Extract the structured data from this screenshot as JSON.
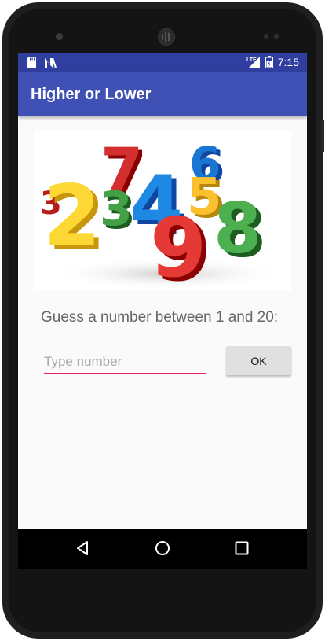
{
  "status_bar": {
    "left_icons": [
      "sd-card-icon",
      "n-notification-icon"
    ],
    "network": "LTE",
    "time": "7:15"
  },
  "app_bar": {
    "title": "Higher or Lower"
  },
  "hero_image": {
    "digits": [
      "2",
      "7",
      "3",
      "4",
      "6",
      "5",
      "9",
      "8"
    ]
  },
  "prompt": "Guess a number between 1 and 20:",
  "number_input": {
    "placeholder": "Type number",
    "value": ""
  },
  "ok_button": {
    "label": "OK"
  },
  "nav_bar": {
    "icons": [
      "back-icon",
      "home-icon",
      "recents-icon"
    ]
  },
  "colors": {
    "status_bar": "#303f9f",
    "app_bar": "#3f51b5",
    "input_underline": "#e91e63",
    "button_bg": "#e0e0e0",
    "screen_bg": "#fafafa"
  }
}
